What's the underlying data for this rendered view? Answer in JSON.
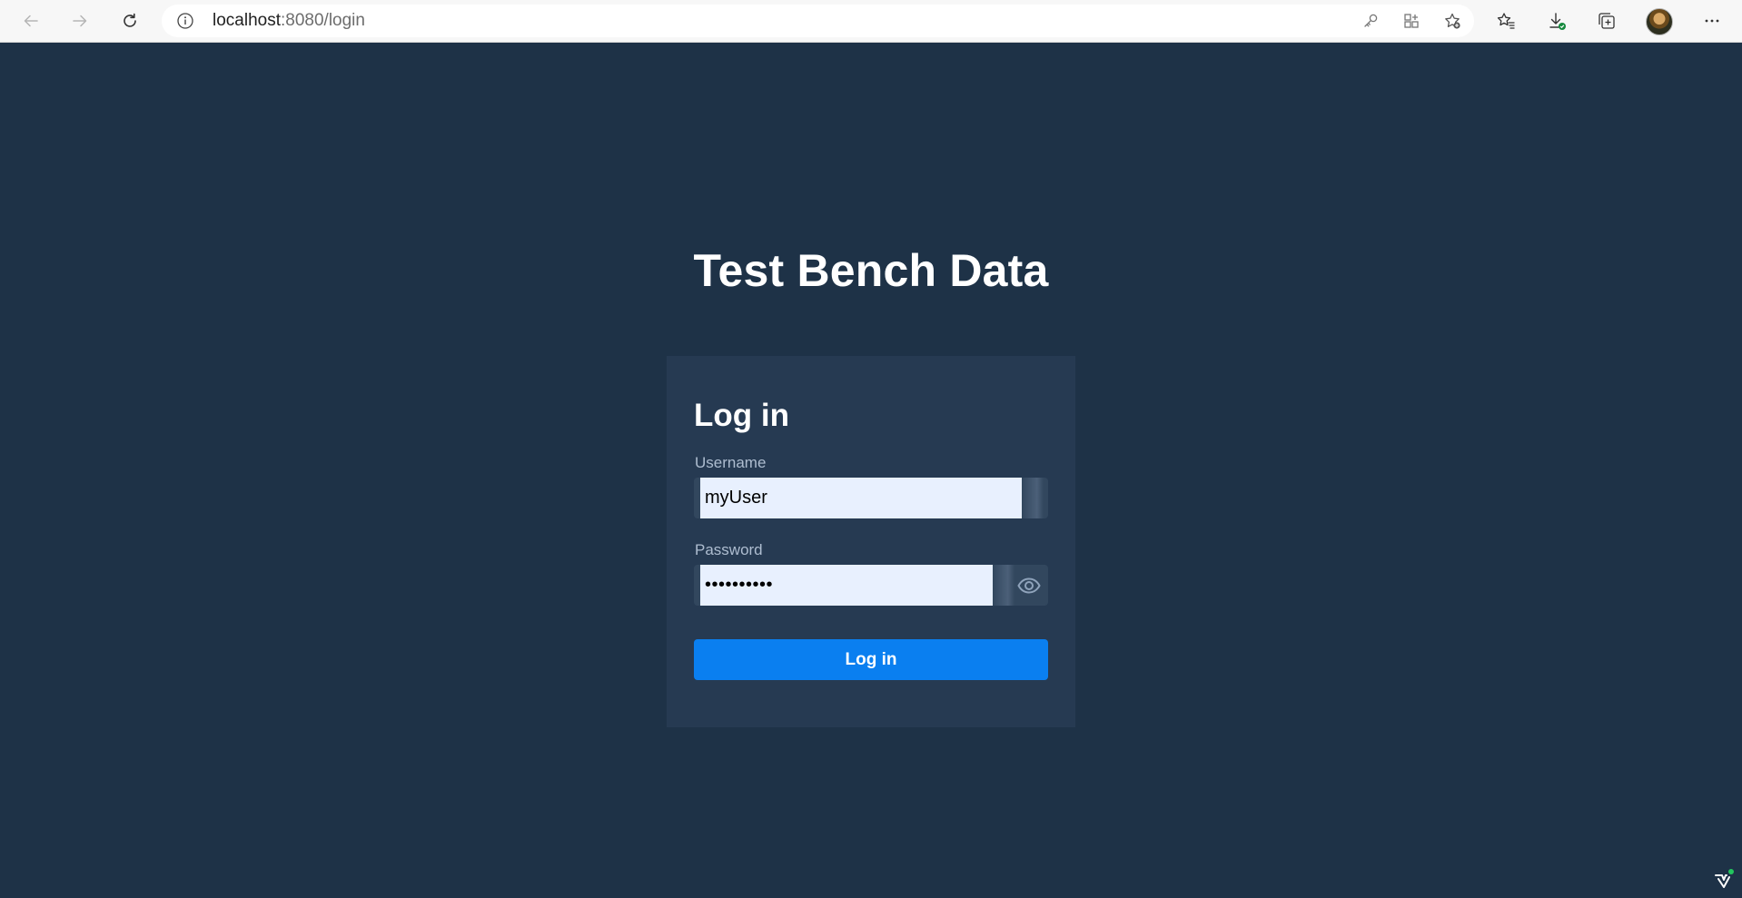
{
  "browser": {
    "url_host": "localhost",
    "url_rest": ":8080/login",
    "icons": {
      "back": "back-arrow-icon",
      "forward": "forward-arrow-icon",
      "refresh": "refresh-icon",
      "site_info": "info-icon",
      "password_key": "key-icon",
      "app_available": "app-icon",
      "add_favorite": "star-add-icon",
      "favorites": "favorites-icon",
      "downloads": "download-icon",
      "collections": "collections-icon",
      "profile": "avatar",
      "more": "more-icon"
    }
  },
  "page": {
    "app_title": "Test Bench Data",
    "background_color": "#1e3247",
    "login": {
      "heading": "Log in",
      "username_label": "Username",
      "username_value": "myUser",
      "password_label": "Password",
      "password_value": "••••••••••",
      "submit_label": "Log in",
      "accent_color": "#0a7ff0"
    }
  }
}
